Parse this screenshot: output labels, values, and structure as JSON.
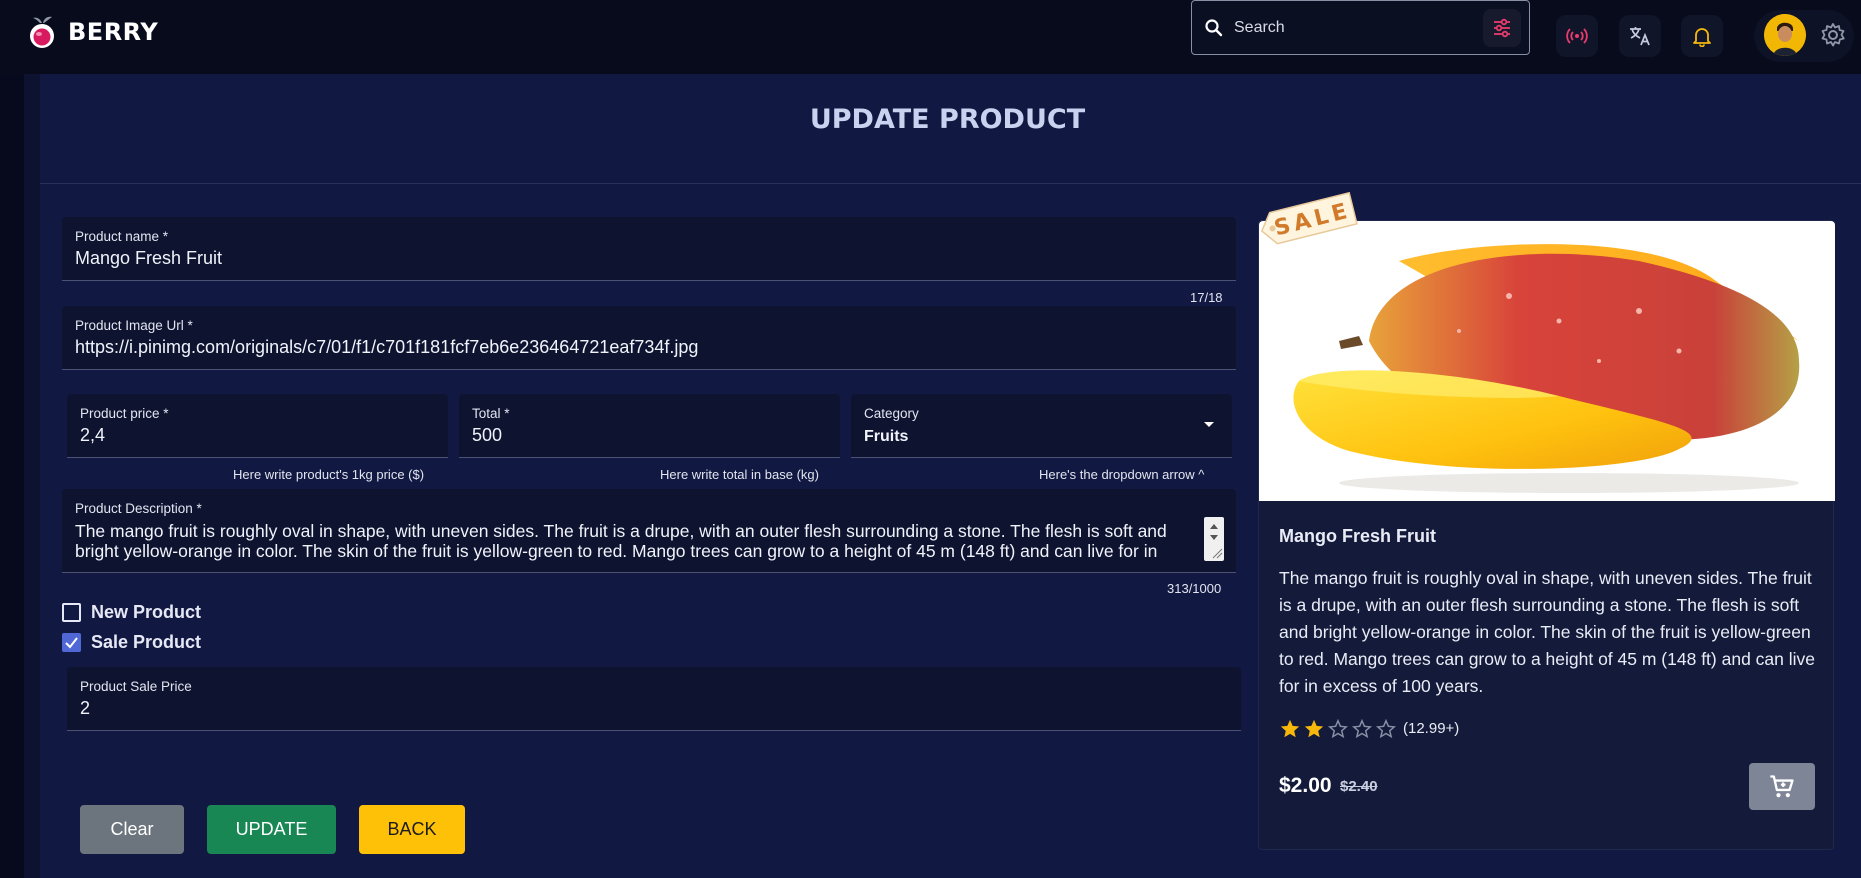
{
  "brand": {
    "name": "BERRY"
  },
  "search": {
    "placeholder": "Search"
  },
  "page": {
    "title": "UPDATE PRODUCT"
  },
  "form": {
    "product_name": {
      "label": "Product name *",
      "value": "Mango Fresh Fruit",
      "counter": "17/18"
    },
    "image_url": {
      "label": "Product Image Url *",
      "value": "https://i.pinimg.com/originals/c7/01/f1/c701f181fcf7eb6e236464721eaf734f.jpg"
    },
    "price": {
      "label": "Product price *",
      "value": "2,4",
      "helper": "Here write product's 1kg price ($)"
    },
    "total": {
      "label": "Total *",
      "value": "500",
      "helper": "Here write total in base (kg)"
    },
    "category": {
      "label": "Category",
      "value": "Fruits",
      "helper": "Here's the dropdown arrow ^"
    },
    "description": {
      "label": "Product Description *",
      "value": "The mango fruit is roughly oval in shape, with uneven sides. The fruit is a drupe, with an outer flesh surrounding a stone. The flesh is soft and bright yellow-orange in color. The skin of the fruit is yellow-green to red. Mango trees can grow to a height of 45 m (148 ft) and can live for in excess of 100 years.",
      "counter": "313/1000"
    },
    "new_product": {
      "label": "New Product",
      "checked": false
    },
    "sale_product": {
      "label": "Sale Product",
      "checked": true
    },
    "sale_price": {
      "label": "Product Sale Price",
      "value": "2"
    }
  },
  "buttons": {
    "clear": "Clear",
    "update": "UPDATE",
    "back": "BACK"
  },
  "card": {
    "sale_tag": "SALE",
    "title": "Mango Fresh Fruit",
    "description": "The mango fruit is roughly oval in shape, with uneven sides. The fruit is a drupe, with an outer flesh surrounding a stone. The flesh is soft and bright yellow-orange in color. The skin of the fruit is yellow-green to red. Mango trees can grow to a height of 45 m (148 ft) and can live for in excess of 100 years.",
    "rating": 2,
    "rating_max": 5,
    "rating_count": "(12.99+)",
    "price": "$2.00",
    "old_price": "$2.40"
  },
  "colors": {
    "accent": "#5067d6",
    "update": "#198754",
    "back": "#ffc107",
    "clear": "#6c757d",
    "star": "#f5b80b"
  }
}
